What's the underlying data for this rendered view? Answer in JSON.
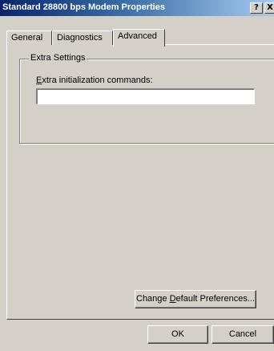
{
  "window": {
    "title": "Standard 28800 bps Modem Properties",
    "help_glyph": "?",
    "close_glyph": "X"
  },
  "tabs": [
    {
      "label": "General"
    },
    {
      "label": "Diagnostics"
    },
    {
      "label": "Advanced",
      "selected": true
    }
  ],
  "extra_settings": {
    "group_label": "Extra Settings",
    "field_label_access_key": "E",
    "field_label_rest": "xtra initialization commands:",
    "field_value": ""
  },
  "buttons": {
    "change_default_pre": "Change ",
    "change_default_key": "D",
    "change_default_post": "efault Preferences...",
    "ok": "OK",
    "cancel": "Cancel"
  },
  "colors": {
    "title_start": "#0a246a",
    "title_end": "#a6caf0",
    "face": "#d4d0c8"
  }
}
